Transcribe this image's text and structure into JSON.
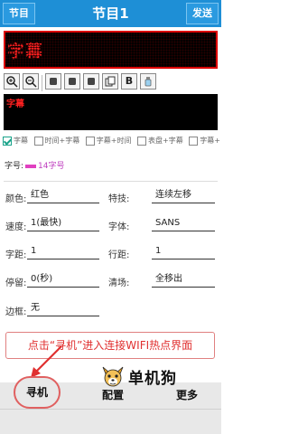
{
  "header": {
    "left_button": "节目",
    "title": "节目1",
    "right_button": "发送"
  },
  "preview": {
    "text": "字幕"
  },
  "toolbar": {
    "bold_label": "B"
  },
  "edit": {
    "text": "字幕"
  },
  "checks": [
    {
      "label": "字幕",
      "checked": true
    },
    {
      "label": "时间+字幕",
      "checked": false
    },
    {
      "label": "字幕+时间",
      "checked": false
    },
    {
      "label": "表盘+字幕",
      "checked": false
    },
    {
      "label": "字幕+",
      "checked": false
    }
  ],
  "font_size": {
    "label": "字号:",
    "value": "14字号"
  },
  "settings": {
    "color_label": "颜色:",
    "color_value": "红色",
    "effect_label": "特技:",
    "effect_value": "连续左移",
    "speed_label": "速度:",
    "speed_value": "1(最快)",
    "font_label": "字体:",
    "font_value": "SANS",
    "char_spacing_label": "字距:",
    "char_spacing_value": "1",
    "line_spacing_label": "行距:",
    "line_spacing_value": "1",
    "stay_label": "停留:",
    "stay_value": "0(秒)",
    "clear_label": "清场:",
    "clear_value": "全移出",
    "border_label": "边框:",
    "border_value": "无"
  },
  "wifi_note": "点击“寻机”进入连接WIFI热点界面",
  "watermark": {
    "text": "单机狗"
  },
  "bottom_nav": {
    "find": "寻机",
    "config": "配置",
    "more": "更多"
  },
  "colors": {
    "header": "#1e8fd6",
    "led_red": "#ff2020",
    "note_red": "#e03030"
  }
}
